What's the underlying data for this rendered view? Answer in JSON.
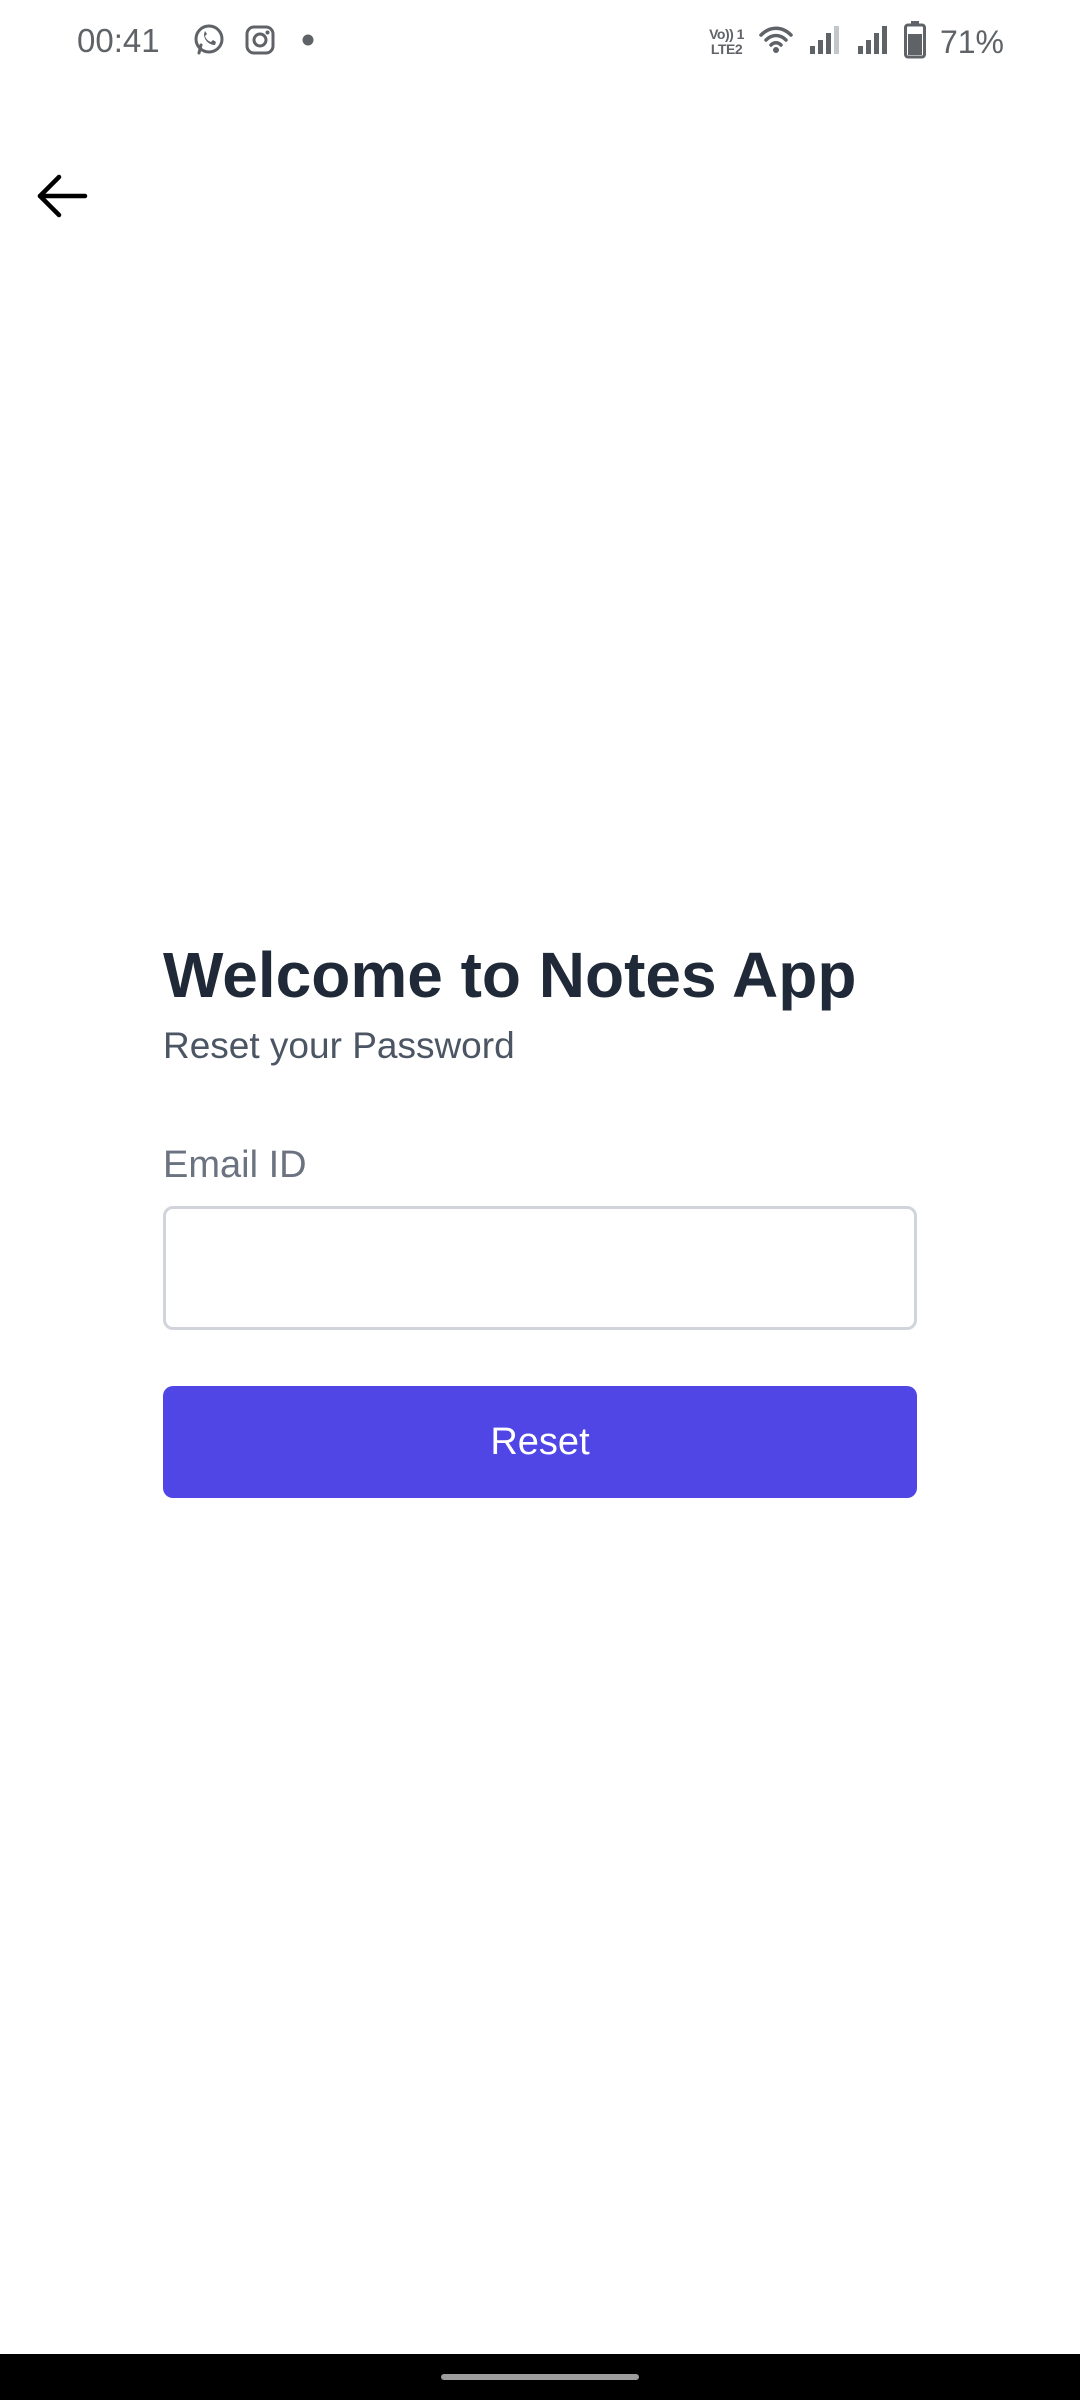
{
  "status_bar": {
    "time": "00:41",
    "notification_icons": [
      "whatsapp-icon",
      "instagram-icon",
      "dot-icon"
    ],
    "volte_line1": "Vo)) 1",
    "volte_line2": "LTE2",
    "battery_percent": "71%",
    "battery_level": 0.71
  },
  "header": {
    "back_icon": "arrow-left-icon"
  },
  "main": {
    "title": "Welcome to Notes App",
    "subtitle": "Reset your Password",
    "email_label": "Email ID",
    "email_value": "",
    "email_placeholder": "",
    "reset_label": "Reset"
  },
  "colors": {
    "primary": "#4f46e5",
    "title": "#1f2937",
    "subtitle": "#4b5563",
    "label": "#6b7280",
    "input_border": "#d1d5db",
    "nav_bar": "#000000"
  }
}
